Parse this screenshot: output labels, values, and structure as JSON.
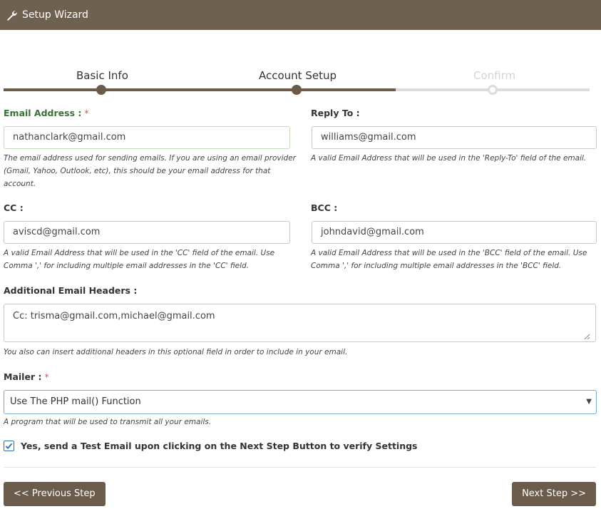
{
  "window": {
    "title": "Setup Wizard",
    "icon": "wrench-icon"
  },
  "stepper": {
    "steps": [
      {
        "label": "Basic Info",
        "state": "complete"
      },
      {
        "label": "Account Setup",
        "state": "current"
      },
      {
        "label": "Confirm",
        "state": "pending"
      }
    ],
    "progress_fraction": 0.66
  },
  "form": {
    "email": {
      "label": "Email Address :",
      "required_mark": "*",
      "value": "nathanclark@gmail.com",
      "help": "The email address used for sending emails. If you are using an email provider (Gmail, Yahoo, Outlook, etc), this should be your email address for that account."
    },
    "reply_to": {
      "label": "Reply To :",
      "value": "williams@gmail.com",
      "help": "A valid Email Address that will be used in the 'Reply-To' field of the email."
    },
    "cc": {
      "label": "CC :",
      "value": "aviscd@gmail.com",
      "help": "A valid Email Address that will be used in the 'CC' field of the email. Use Comma ',' for including multiple email addresses in the 'CC' field."
    },
    "bcc": {
      "label": "BCC :",
      "value": "johndavid@gmail.com",
      "help": "A valid Email Address that will be used in the 'BCC' field of the email. Use Comma ',' for including multiple email addresses in the 'BCC' field."
    },
    "headers": {
      "label": "Additional Email Headers :",
      "value": "Cc: trisma@gmail.com,michael@gmail.com",
      "help": "You also can insert additional headers in this optional field in order to include in your email."
    },
    "mailer": {
      "label": "Mailer :",
      "required_mark": "*",
      "selected": "Use The PHP mail() Function",
      "help": "A program that will be used to transmit all your emails."
    },
    "test_email": {
      "label": "Yes, send a Test Email upon clicking on the Next Step Button to verify Settings",
      "checked": true
    }
  },
  "footer": {
    "prev_label": "<< Previous Step",
    "next_label": "Next Step >>"
  },
  "colors": {
    "header": "#6f6150",
    "accent": "#6b5b4b",
    "required": "#d9534f",
    "label_green": "#3c6e37"
  }
}
